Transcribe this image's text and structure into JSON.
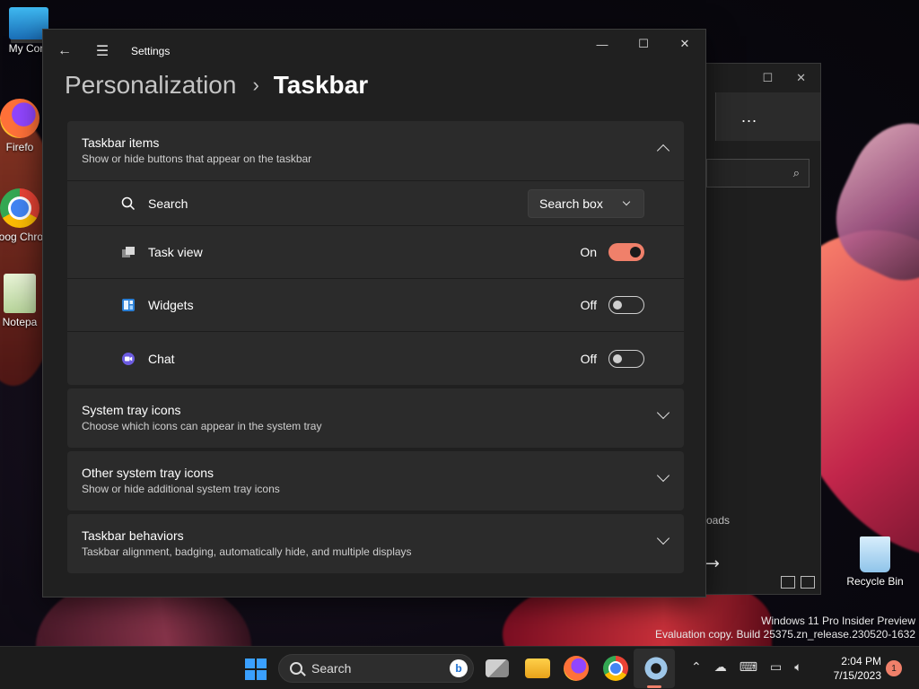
{
  "desktop": {
    "icons": [
      {
        "label": "My Com"
      },
      {
        "label": "Firefo"
      },
      {
        "label": "Goog Chron"
      },
      {
        "label": "Notepa"
      },
      {
        "label": "Recycle Bin"
      }
    ],
    "watermark": {
      "line1": "Windows 11 Pro Insider Preview",
      "line2": "Evaluation copy. Build 25375.zn_release.230520-1632"
    }
  },
  "bg_window": {
    "more_label": "...",
    "downloads_label": "oads"
  },
  "settings": {
    "window_title": "Settings",
    "breadcrumb": {
      "parent": "Personalization",
      "current": "Taskbar"
    },
    "sections": [
      {
        "title": "Taskbar items",
        "subtitle": "Show or hide buttons that appear on the taskbar",
        "expanded": true,
        "items": [
          {
            "label": "Search",
            "icon": "search-icon",
            "control": "dropdown",
            "value": "Search box"
          },
          {
            "label": "Task view",
            "icon": "task-view-icon",
            "control": "toggle",
            "state": "On"
          },
          {
            "label": "Widgets",
            "icon": "widgets-icon",
            "control": "toggle",
            "state": "Off"
          },
          {
            "label": "Chat",
            "icon": "chat-icon",
            "control": "toggle",
            "state": "Off"
          }
        ]
      },
      {
        "title": "System tray icons",
        "subtitle": "Choose which icons can appear in the system tray",
        "expanded": false
      },
      {
        "title": "Other system tray icons",
        "subtitle": "Show or hide additional system tray icons",
        "expanded": false
      },
      {
        "title": "Taskbar behaviors",
        "subtitle": "Taskbar alignment, badging, automatically hide, and multiple displays",
        "expanded": false
      }
    ]
  },
  "taskbar": {
    "search_label": "Search",
    "bing_label": "b",
    "clock": {
      "time": "2:04 PM",
      "date": "7/15/2023"
    },
    "notification_count": "1"
  },
  "colors": {
    "accent": "#f0806a",
    "window_bg": "#202020",
    "card_bg": "#2b2b2b",
    "taskbar_bg": "#1c1c1c"
  }
}
